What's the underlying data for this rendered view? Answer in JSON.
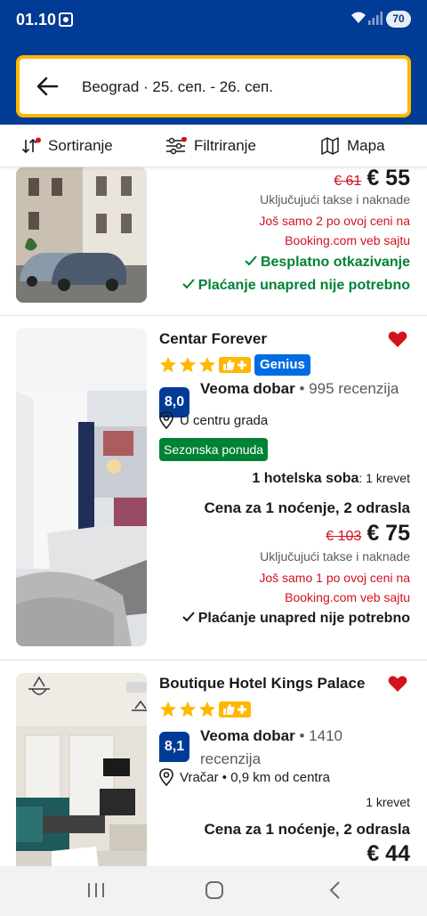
{
  "status_bar": {
    "time": "01.10",
    "battery": "70"
  },
  "search": {
    "summary": "Beograd · 25. сеп. - 26. сеп."
  },
  "toolbar": {
    "sort_label": "Sortiranje",
    "filter_label": "Filtriranje",
    "map_label": "Mapa"
  },
  "cards": [
    {
      "price_old": "€ 61",
      "price_new": "€ 55",
      "taxes": "Uključujući takse i naknade",
      "scarcity_line1": "Još samo 2 po ovoj ceni na",
      "scarcity_line2": "Booking.com veb sajtu",
      "free_cancel": "Besplatno otkazivanje",
      "no_prepay": "Plaćanje unapred nije potrebno"
    },
    {
      "title": "Centar Forever",
      "stars": 3,
      "genius": "Genius",
      "score": "8,0",
      "rating_word": "Veoma dobar",
      "rating_count": "• 995 recenzija",
      "location": "U centru grada",
      "badge": "Sezonska ponuda",
      "room_type": "1 hotelska soba",
      "room_beds": ": 1 krevet",
      "price_for": "Cena za 1 noćenje, 2 odrasla",
      "price_old": "€ 103",
      "price_new": "€ 75",
      "taxes": "Uključujući takse i naknade",
      "scarcity_line1": "Još samo 1 po ovoj ceni na",
      "scarcity_line2": "Booking.com veb sajtu",
      "no_prepay": "Plaćanje unapred nije potrebno"
    },
    {
      "title": "Boutique Hotel Kings Palace",
      "stars": 3,
      "score": "8,1",
      "rating_word": "Veoma dobar",
      "rating_count_line1": "• 1410",
      "rating_count_line2": "recenzija",
      "location": "Vračar • 0,9 km od centra",
      "room_beds": "1 krevet",
      "price_for": "Cena za 1 noćenje, 2 odrasla",
      "price_new": "€ 44"
    }
  ],
  "colors": {
    "brand": "#003b95",
    "accent": "#ffb700",
    "genius": "#006ce4",
    "green": "#008234",
    "red": "#d4111e"
  },
  "icons": [
    "back-arrow-icon",
    "sort-icon",
    "filter-icon",
    "map-icon",
    "heart-icon",
    "star-icon",
    "location-pin-icon",
    "checkmark-icon",
    "thumbs-plus-icon",
    "recents-icon",
    "home-icon",
    "back-nav-icon"
  ]
}
